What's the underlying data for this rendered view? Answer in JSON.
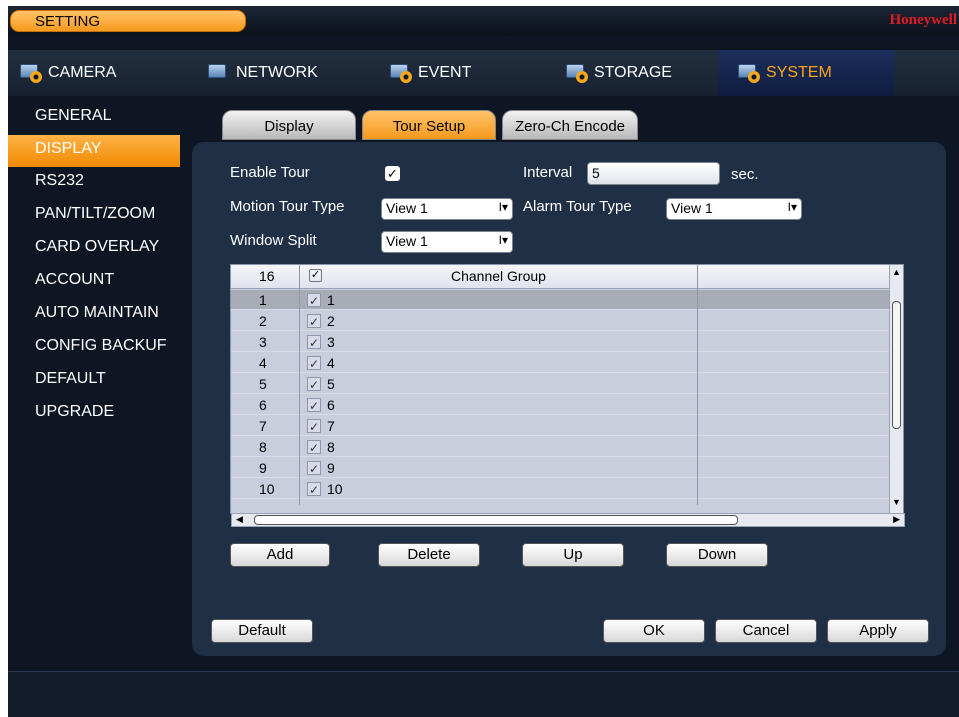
{
  "title": "SETTING",
  "brand": "Honeywell",
  "main_tabs": [
    {
      "label": "CAMERA",
      "icon": "camera-icon"
    },
    {
      "label": "NETWORK",
      "icon": "network-icon"
    },
    {
      "label": "EVENT",
      "icon": "event-icon"
    },
    {
      "label": "STORAGE",
      "icon": "storage-icon"
    },
    {
      "label": "SYSTEM",
      "icon": "system-icon",
      "selected": true
    }
  ],
  "sidebar": [
    "GENERAL",
    "DISPLAY",
    "RS232",
    "PAN/TILT/ZOOM",
    "CARD OVERLAY",
    "ACCOUNT",
    "AUTO MAINTAIN",
    "CONFIG BACKUF",
    "DEFAULT",
    "UPGRADE"
  ],
  "sub_tabs": [
    "Display",
    "Tour Setup",
    "Zero-Ch Encode"
  ],
  "form": {
    "enable_tour_label": "Enable Tour",
    "enable_tour_check": "✓",
    "interval_label": "Interval",
    "interval_value": "5",
    "interval_unit": "sec.",
    "motion_label": "Motion Tour Type",
    "motion_value": "View 1",
    "alarm_label": "Alarm Tour Type",
    "alarm_value": "View 1",
    "split_label": "Window Split",
    "split_value": "View 1",
    "dd_arrow": "I▾"
  },
  "table": {
    "head_num": "16",
    "head_check": "✓",
    "head_group": "Channel Group",
    "rows": [
      {
        "num": "1",
        "group": "1"
      },
      {
        "num": "2",
        "group": "2"
      },
      {
        "num": "3",
        "group": "3"
      },
      {
        "num": "4",
        "group": "4"
      },
      {
        "num": "5",
        "group": "5"
      },
      {
        "num": "6",
        "group": "6"
      },
      {
        "num": "7",
        "group": "7"
      },
      {
        "num": "8",
        "group": "8"
      },
      {
        "num": "9",
        "group": "9"
      },
      {
        "num": "10",
        "group": "10"
      }
    ]
  },
  "buttons": {
    "add": "Add",
    "delete": "Delete",
    "up": "Up",
    "down": "Down",
    "default": "Default",
    "ok": "OK",
    "cancel": "Cancel",
    "apply": "Apply"
  }
}
